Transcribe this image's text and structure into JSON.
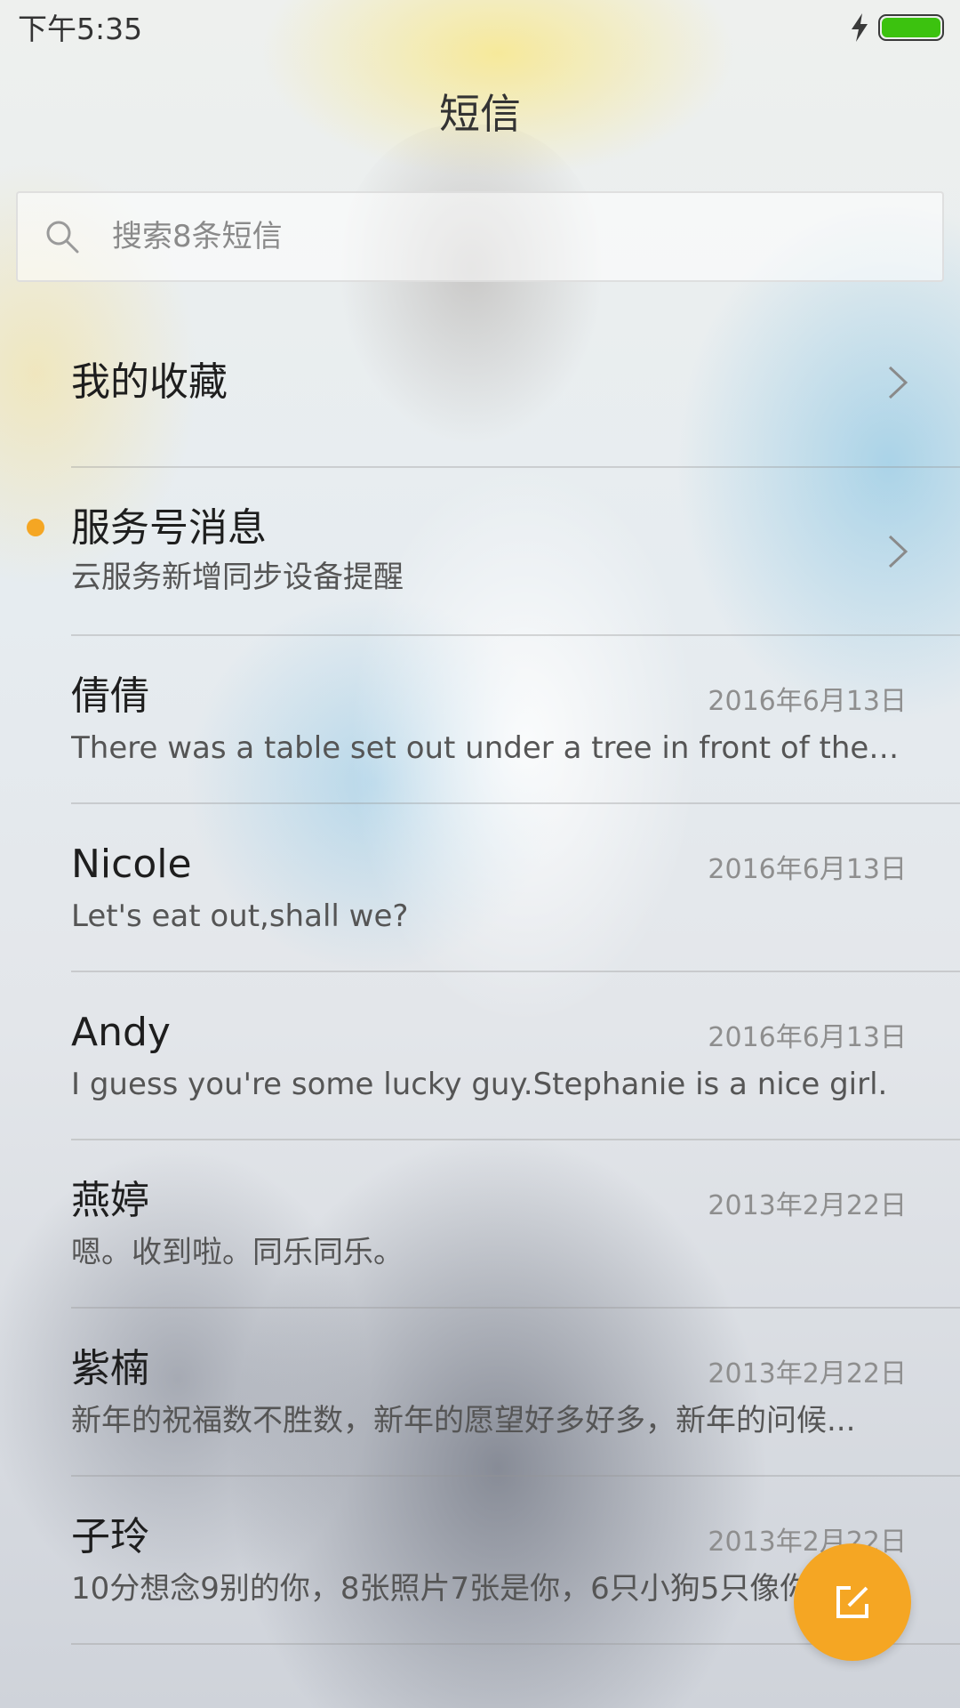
{
  "status_bar": {
    "time": "下午5:35",
    "charging": true,
    "battery_level": 1.0,
    "battery_color": "#3cc20f"
  },
  "header": {
    "title": "短信"
  },
  "search": {
    "placeholder": "搜索8条短信",
    "value": ""
  },
  "favorites": {
    "label": "我的收藏"
  },
  "service": {
    "title": "服务号消息",
    "subtitle": "云服务新增同步设备提醒",
    "unread": true,
    "dot_color": "#f5a623"
  },
  "conversations": [
    {
      "name": "倩倩",
      "date": "2016年6月13日",
      "preview": "There was a table set out under a tree in front of the ho..."
    },
    {
      "name": "Nicole",
      "date": "2016年6月13日",
      "preview": "Let's eat out,shall we?"
    },
    {
      "name": "Andy",
      "date": "2016年6月13日",
      "preview": "I guess you're some lucky guy.Stephanie is a nice girl."
    },
    {
      "name": "燕婷",
      "date": "2013年2月22日",
      "preview": "嗯。收到啦。同乐同乐。"
    },
    {
      "name": "紫楠",
      "date": "2013年2月22日",
      "preview": "新年的祝福数不胜数，新年的愿望好多好多，新年的问候..."
    },
    {
      "name": "子玲",
      "date": "2013年2月22日",
      "preview": "10分想念9别的你，8张照片7张是你，6只小狗5只像你"
    }
  ],
  "fab": {
    "icon": "compose-icon",
    "color": "#f5a623"
  },
  "icons": {
    "search": "search-icon",
    "chevron": "chevron-right-icon",
    "charging": "lightning-icon"
  }
}
